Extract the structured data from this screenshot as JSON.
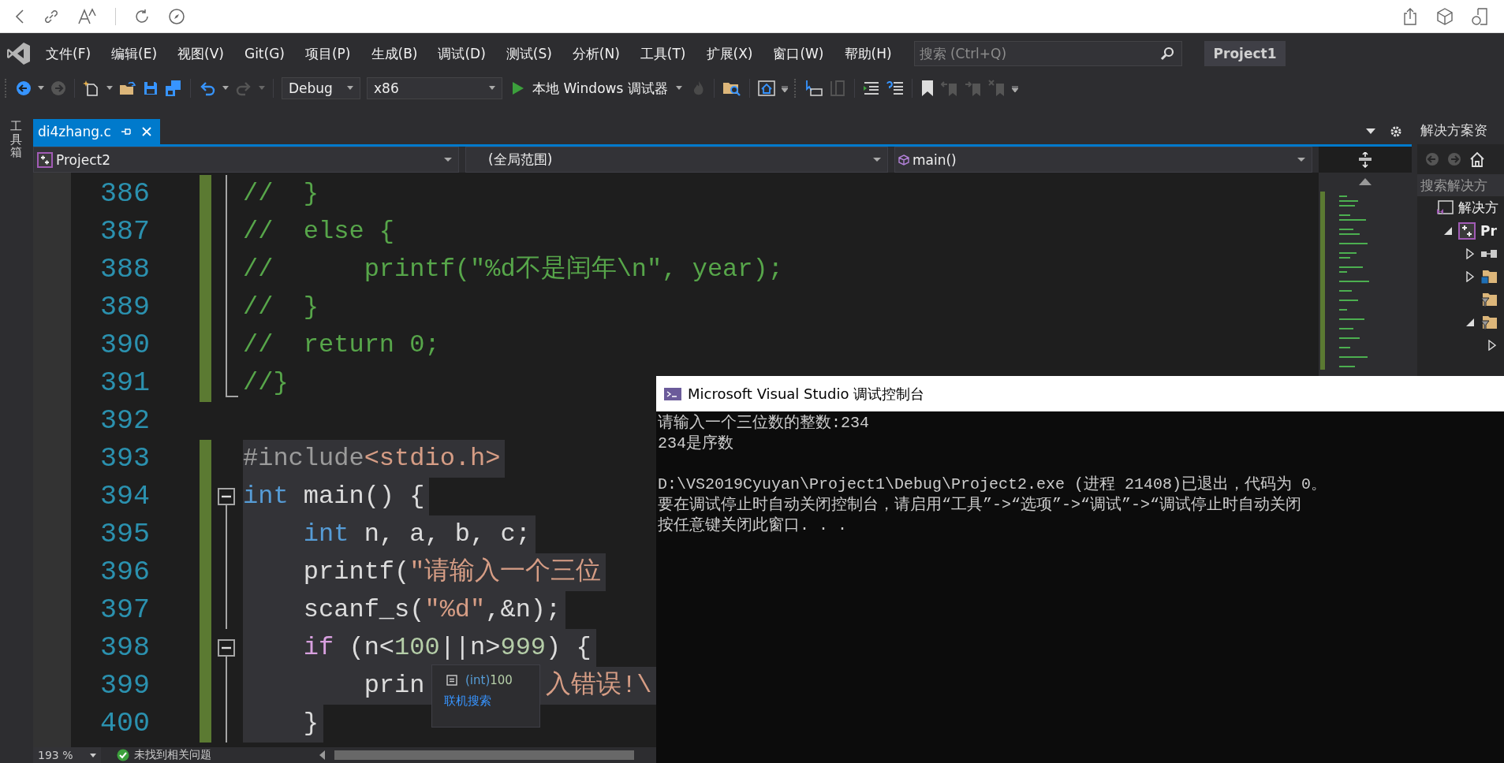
{
  "menu": {
    "items": [
      "文件(F)",
      "编辑(E)",
      "视图(V)",
      "Git(G)",
      "项目(P)",
      "生成(B)",
      "调试(D)",
      "测试(S)",
      "分析(N)",
      "工具(T)",
      "扩展(X)",
      "窗口(W)",
      "帮助(H)"
    ],
    "search": {
      "placeholder": "搜索 (Ctrl+Q)"
    },
    "project_badge": "Project1"
  },
  "toolbar": {
    "configuration": "Debug",
    "platform": "x86",
    "run_button": "本地 Windows 调试器"
  },
  "tool_strip": {
    "label": "工具箱"
  },
  "editor": {
    "tab": {
      "title": "di4zhang.c",
      "selected": true
    },
    "nav": {
      "project": "Project2",
      "scope": "(全局范围)",
      "member": "main()"
    },
    "lines": [
      {
        "number": "386",
        "changed": true,
        "highlighted": false,
        "kind": "inside",
        "tokens": [
          {
            "kind": "comment",
            "text": "//  }"
          }
        ]
      },
      {
        "number": "387",
        "changed": true,
        "highlighted": false,
        "kind": "inside",
        "tokens": [
          {
            "kind": "comment",
            "text": "//  else {"
          }
        ]
      },
      {
        "number": "388",
        "changed": true,
        "highlighted": false,
        "kind": "inside",
        "tokens": [
          {
            "kind": "comment",
            "text": "//      printf(\"%d不是闰年\\n\", year);"
          }
        ]
      },
      {
        "number": "389",
        "changed": true,
        "highlighted": false,
        "kind": "inside",
        "tokens": [
          {
            "kind": "comment",
            "text": "//  }"
          }
        ]
      },
      {
        "number": "390",
        "changed": true,
        "highlighted": false,
        "kind": "inside",
        "tokens": [
          {
            "kind": "comment",
            "text": "//  return 0;"
          }
        ]
      },
      {
        "number": "391",
        "changed": true,
        "highlighted": false,
        "kind": "end",
        "tokens": [
          {
            "kind": "comment",
            "text": "//}"
          }
        ]
      },
      {
        "number": "392",
        "changed": false
      },
      {
        "number": "393",
        "changed": true,
        "highlighted": true,
        "tokens": [
          {
            "kind": "preproc",
            "text": "#include"
          },
          {
            "kind": "string",
            "text": "<stdio.h>"
          }
        ]
      },
      {
        "number": "394",
        "changed": true,
        "highlighted": true,
        "kind": "start",
        "tokens": [
          {
            "kind": "keyword",
            "text": "int"
          },
          {
            "kind": "plain",
            "text": " main() {"
          }
        ]
      },
      {
        "number": "395",
        "changed": true,
        "highlighted": true,
        "kind": "inside",
        "tokens": [
          {
            "kind": "keyword",
            "text": "    int"
          },
          {
            "kind": "plain",
            "text": " n, a, b, c;"
          }
        ]
      },
      {
        "number": "396",
        "changed": true,
        "highlighted": true,
        "kind": "inside",
        "tokens": [
          {
            "kind": "plain",
            "text": "    printf("
          },
          {
            "kind": "string",
            "text": "\"请输入一个三位"
          }
        ]
      },
      {
        "number": "397",
        "changed": true,
        "highlighted": true,
        "kind": "inside",
        "tokens": [
          {
            "kind": "plain",
            "text": "    scanf_s("
          },
          {
            "kind": "string",
            "text": "\"%d\""
          },
          {
            "kind": "plain",
            "text": ",&n);"
          }
        ]
      },
      {
        "number": "398",
        "changed": true,
        "highlighted": true,
        "kind": "start",
        "tokens": [
          {
            "kind": "control",
            "text": "    if"
          },
          {
            "kind": "plain",
            "text": " (n<"
          },
          {
            "kind": "number",
            "text": "100"
          },
          {
            "kind": "plain",
            "text": "||n>"
          },
          {
            "kind": "number",
            "text": "999"
          },
          {
            "kind": "plain",
            "text": ") {"
          }
        ]
      },
      {
        "number": "399",
        "changed": true,
        "highlighted": true,
        "kind": "inside",
        "tokens": [
          {
            "kind": "plain",
            "text": "        prin"
          },
          {
            "kind": "gap"
          },
          {
            "kind": "string",
            "text": "入错误!\\"
          }
        ]
      },
      {
        "number": "400",
        "changed": true,
        "highlighted": true,
        "kind": "inside",
        "tokens": [
          {
            "kind": "plain",
            "text": "    }"
          }
        ]
      }
    ]
  },
  "tooltip": {
    "type": "(int)",
    "value": "100",
    "link": "联机搜索"
  },
  "status_bar": {
    "zoom": "193 %",
    "issues": "未找到相关问题"
  },
  "solution_explorer": {
    "title": "解决方案资",
    "search_placeholder": "搜索解决方",
    "tree": [
      {
        "kind": "solution",
        "label": "解决方",
        "children": [
          {
            "kind": "project",
            "label": "Pr",
            "expanded": true,
            "children": [
              {
                "kind": "references",
                "expanded": false
              },
              {
                "kind": "folder",
                "expanded": false
              },
              {
                "kind": "filter"
              },
              {
                "kind": "filter",
                "expanded": true,
                "children": [
                  {
                    "expanded": false
                  }
                ]
              }
            ]
          }
        ]
      }
    ]
  },
  "console": {
    "title": "Microsoft Visual Studio 调试控制台",
    "output": [
      "请输入一个三位数的整数:234",
      "234是序数"
    ],
    "messages": [
      "D:\\VS2019Cyuyan\\Project1\\Debug\\Project2.exe (进程 21408)已退出，代码为 0。",
      "要在调试停止时自动关闭控制台，请启用“工具”->“选项”->“调试”->“调试停止时自动关闭",
      "按任意键关闭此窗口. . ."
    ]
  }
}
